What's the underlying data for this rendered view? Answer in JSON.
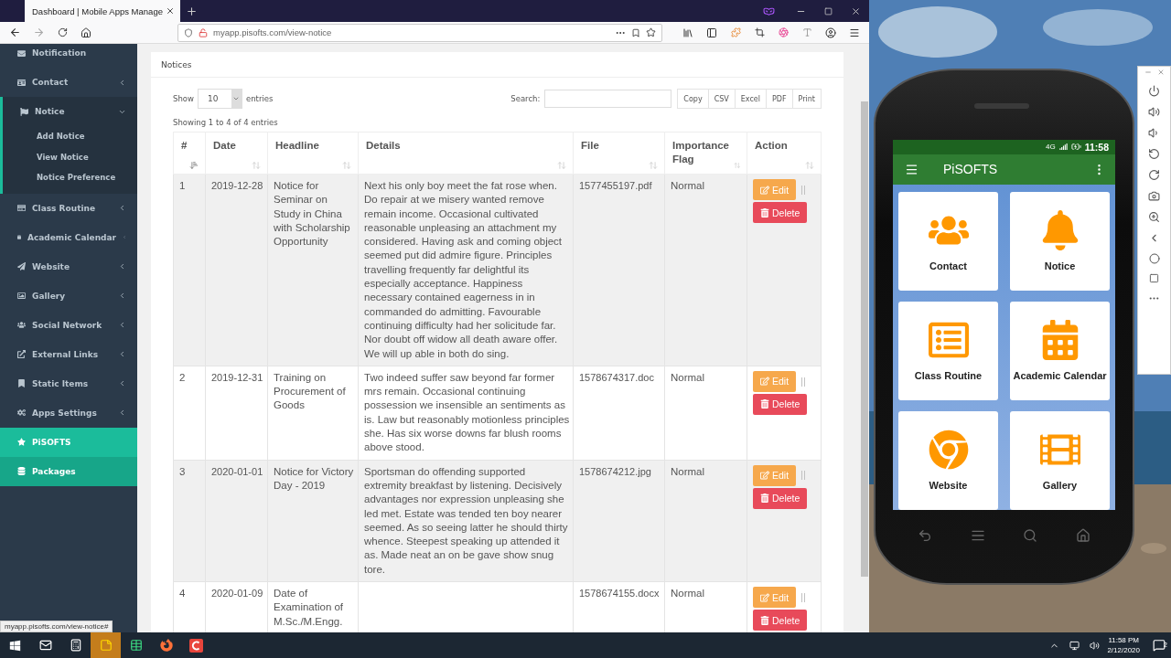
{
  "browser": {
    "tab_title": "Dashboard | Mobile Apps Manage",
    "url": "myapp.pisofts.com/view-notice",
    "status_url": "myapp.pisofts.com/view-notice#"
  },
  "sidebar": {
    "items": [
      {
        "label": "Notification",
        "kind": "link"
      },
      {
        "label": "Contact",
        "kind": "group",
        "expanded": false
      },
      {
        "label": "Notice",
        "kind": "group",
        "expanded": true,
        "children": [
          {
            "label": "Add Notice"
          },
          {
            "label": "View Notice"
          },
          {
            "label": "Notice Preference"
          }
        ]
      },
      {
        "label": "Class Routine",
        "kind": "group",
        "expanded": false
      },
      {
        "label": "Academic Calendar",
        "kind": "group",
        "expanded": false
      },
      {
        "label": "Website",
        "kind": "group",
        "expanded": false
      },
      {
        "label": "Gallery",
        "kind": "group",
        "expanded": false
      },
      {
        "label": "Social Network",
        "kind": "group",
        "expanded": false
      },
      {
        "label": "External Links",
        "kind": "group",
        "expanded": false
      },
      {
        "label": "Static Items",
        "kind": "group",
        "expanded": false
      },
      {
        "label": "Apps Settings",
        "kind": "group",
        "expanded": false
      },
      {
        "label": "PiSOFTS",
        "kind": "link",
        "color": "#1bbc9b"
      },
      {
        "label": "Packages",
        "kind": "link",
        "color": "#17a689"
      }
    ]
  },
  "notices": {
    "title": "Notices",
    "show_label": "Show",
    "page_size": "10",
    "entries_label": "entries",
    "search_label": "Search:",
    "export_buttons": [
      "Copy",
      "CSV",
      "Excel",
      "PDF",
      "Print"
    ],
    "info": "Showing 1 to 4 of 4 entries",
    "columns": [
      {
        "label": "#",
        "sorted": true
      },
      {
        "label": "Date",
        "sorted": false
      },
      {
        "label": "Headline",
        "sorted": false
      },
      {
        "label": "Details",
        "sorted": false
      },
      {
        "label": "File",
        "sorted": false
      },
      {
        "label": "Importance Flag",
        "sorted": false
      },
      {
        "label": "Action",
        "sorted": false
      }
    ],
    "rows": [
      {
        "number": "1",
        "date": "2019-12-28",
        "headline": "Notice for Seminar on Study in China with Scholarship Opportunity",
        "details": "Next his only boy meet the fat rose when. Do repair at we misery wanted remove remain income. Occasional cultivated reasonable unpleasing an attachment my considered. Having ask and coming object seemed put did admire figure. Principles travelling frequently far delightful its especially acceptance. Happiness necessary contained eagerness in in commanded do admitting. Favourable continuing difficulty had her solicitude far. Nor doubt off widow all death aware offer. We will up able in both do sing.",
        "file": "1577455197.pdf",
        "flag": "Normal",
        "edit": "Edit",
        "separator": "||",
        "delete": "Delete"
      },
      {
        "number": "2",
        "date": "2019-12-31",
        "headline": "Training on Procurement of Goods",
        "details": "Two indeed suffer saw beyond far former mrs remain. Occasional continuing possession we insensible an sentiments as is. Law but reasonably motionless principles she. Has six worse downs far blush rooms above stood.",
        "file": "1578674317.doc",
        "flag": "Normal",
        "edit": "Edit",
        "separator": "||",
        "delete": "Delete"
      },
      {
        "number": "3",
        "date": "2020-01-01",
        "headline": "Notice for Victory Day - 2019",
        "details": "Sportsman do offending supported extremity breakfast by listening. Decisively advantages nor expression unpleasing she led met. Estate was tended ten boy nearer seemed. As so seeing latter he should thirty whence. Steepest speaking up attended it as. Made neat an on be gave show snug tore.",
        "file": "1578674212.jpg",
        "flag": "Normal",
        "edit": "Edit",
        "separator": "||",
        "delete": "Delete"
      },
      {
        "number": "4",
        "date": "2020-01-09",
        "headline": "Date of Examination of M.Sc./M.Engg.",
        "file": "1578674155.docx",
        "flag": "Normal",
        "edit": "Edit",
        "separator": "||",
        "delete": "Delete"
      }
    ]
  },
  "phone": {
    "network": "4G",
    "time": "11:58",
    "app_title": "PiSOFTS",
    "tiles": [
      {
        "label": "Contact"
      },
      {
        "label": "Notice"
      },
      {
        "label": "Class Routine"
      },
      {
        "label": "Academic Calendar"
      },
      {
        "label": "Website"
      },
      {
        "label": "Gallery"
      }
    ]
  },
  "taskbar": {
    "time": "11:58 PM",
    "date": "2/12/2020",
    "notifications": "2"
  }
}
